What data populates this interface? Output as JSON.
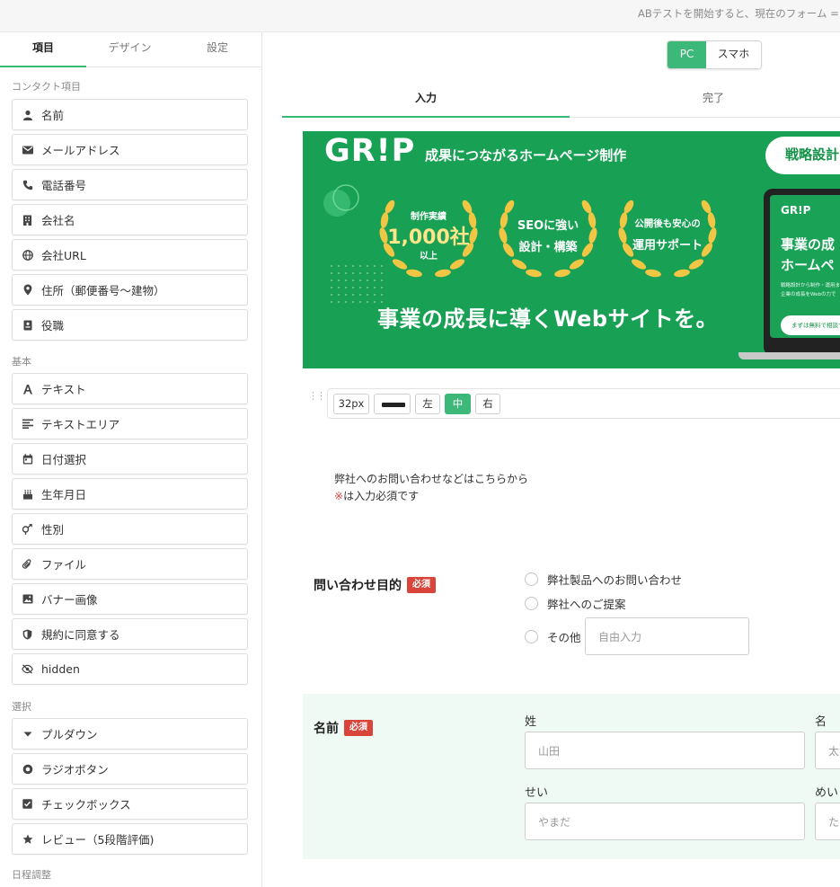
{
  "topbar": {
    "message": "ABテストを開始すると、現在のフォーム = A"
  },
  "sidebar": {
    "tabs": [
      "項目",
      "デザイン",
      "設定"
    ],
    "groups": {
      "contact": "コンタクト項目",
      "basic": "基本",
      "select": "選択",
      "schedule": "日程調整"
    },
    "contact_items": [
      "名前",
      "メールアドレス",
      "電話番号",
      "会社名",
      "会社URL",
      "住所（郵便番号〜建物）",
      "役職"
    ],
    "basic_items": [
      "テキスト",
      "テキストエリア",
      "日付選択",
      "生年月日",
      "性別",
      "ファイル",
      "バナー画像",
      "規約に同意する",
      "hidden"
    ],
    "select_items": [
      "プルダウン",
      "ラジオボタン",
      "チェックボックス",
      "レビュー（5段階評価)"
    ],
    "icons": {
      "contact": [
        "person-icon",
        "mail-icon",
        "phone-icon",
        "building-icon",
        "globe-icon",
        "location-pin-icon",
        "id-card-icon"
      ],
      "basic": [
        "text-icon",
        "textarea-icon",
        "calendar-icon",
        "birthday-cake-icon",
        "gender-icon",
        "paperclip-icon",
        "image-icon",
        "shield-icon",
        "eye-off-icon"
      ],
      "select": [
        "caret-down-icon",
        "radio-icon",
        "checkbox-icon",
        "star-icon"
      ]
    }
  },
  "device_toggle": {
    "pc": "PC",
    "mobile": "スマホ"
  },
  "step_tabs": {
    "input": "入力",
    "complete": "完了"
  },
  "banner": {
    "logo": "GR!P",
    "tagline": "成果につながるホームページ制作",
    "pill": "戦略設計",
    "award1": {
      "line1": "制作実績",
      "line2": "1,000社",
      "line3": "以上"
    },
    "award2": {
      "line1": "SEOに強い",
      "line2": "設計・構築"
    },
    "award3": {
      "line1": "公開後も安心の",
      "line2": "運用サポート"
    },
    "headline": "事業の成長に導くWebサイトを。",
    "laptop": {
      "logo": "GR!P",
      "heading1": "事業の成",
      "heading2": "ホームペ",
      "sub1": "戦略設計から制作・運用ま",
      "sub2": "企業の成長をWebの力で",
      "button": "まずは無料で相談す"
    }
  },
  "image_toolbar": {
    "size": "32px",
    "left": "左",
    "center": "中",
    "right": "右"
  },
  "intro": {
    "line1": "弊社へのお問い合わせなどはこちらから",
    "required_mark": "※",
    "required_text": "は入力必須です"
  },
  "purpose": {
    "label": "問い合わせ目的",
    "badge": "必須",
    "options": [
      "弊社製品へのお問い合わせ",
      "弊社へのご提案",
      "その他"
    ],
    "other_placeholder": "自由入力"
  },
  "name_field": {
    "label": "名前",
    "badge": "必須",
    "last_name": "姓",
    "first_name": "名",
    "last_name_placeholder": "山田",
    "first_name_placeholder": "太",
    "last_kana": "せい",
    "first_kana": "めい",
    "last_kana_placeholder": "やまだ",
    "first_kana_placeholder": "た"
  },
  "colors": {
    "accent": "#3cb878",
    "banner": "#18a054",
    "required": "#d9453b",
    "panel": "#eefaf3"
  }
}
